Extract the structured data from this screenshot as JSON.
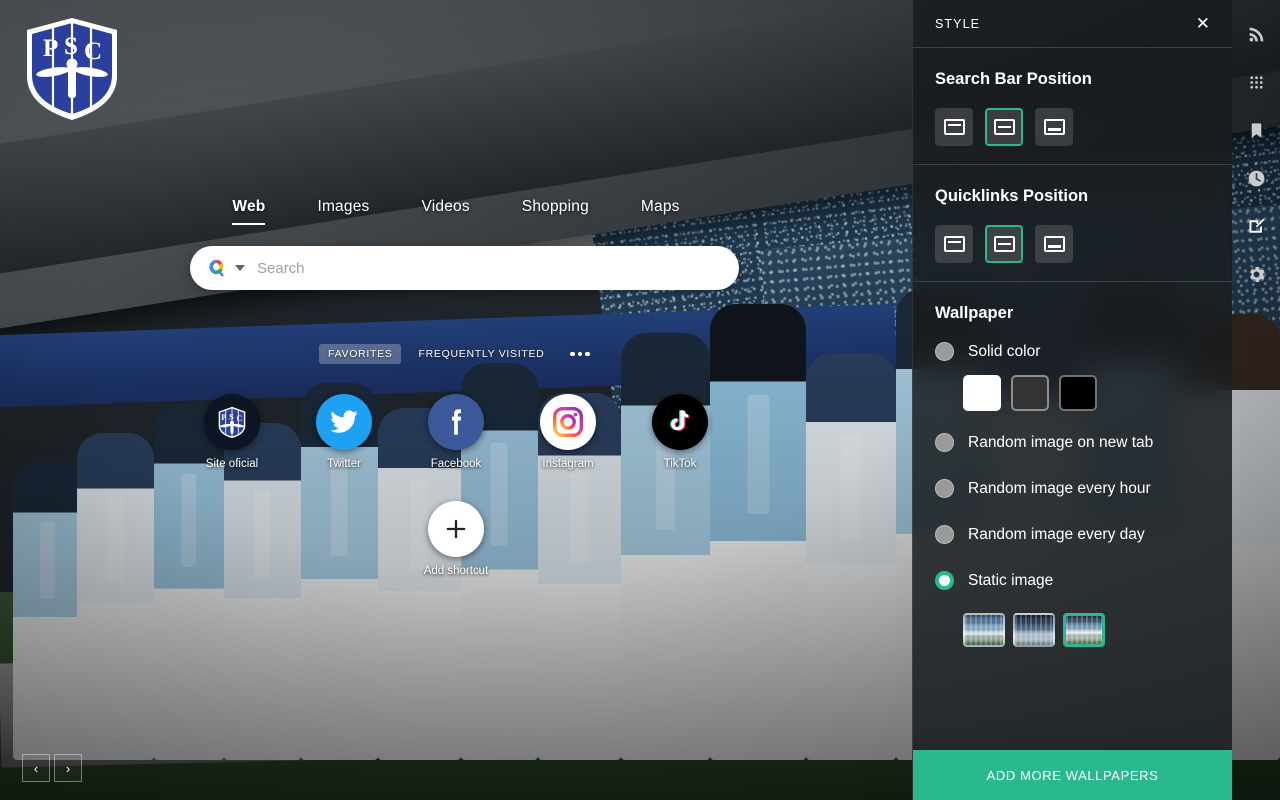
{
  "brand": {
    "logo_alt": "Paysandu Sport Club crest",
    "letters": [
      "P",
      "S",
      "C"
    ]
  },
  "search_tabs": [
    {
      "label": "Web",
      "active": true
    },
    {
      "label": "Images",
      "active": false
    },
    {
      "label": "Videos",
      "active": false
    },
    {
      "label": "Shopping",
      "active": false
    },
    {
      "label": "Maps",
      "active": false
    }
  ],
  "search": {
    "placeholder": "Search",
    "value": "",
    "engine_icon": "google-search-icon"
  },
  "favorites_bar": {
    "tabs": [
      {
        "label": "FAVORITES",
        "active": true
      },
      {
        "label": "FREQUENTLY VISITED",
        "active": false
      }
    ],
    "more_label": "more-options"
  },
  "shortcuts": [
    {
      "label": "Site oficial",
      "icon": "psc-crest-icon"
    },
    {
      "label": "Twitter",
      "icon": "twitter-icon"
    },
    {
      "label": "Facebook",
      "icon": "facebook-icon"
    },
    {
      "label": "Instagram",
      "icon": "instagram-icon"
    },
    {
      "label": "TikTok",
      "icon": "tiktok-icon"
    }
  ],
  "add_shortcut": {
    "label": "Add shortcut",
    "icon": "plus-icon"
  },
  "carousel": {
    "prev": "‹",
    "next": "›"
  },
  "panel": {
    "title": "STYLE",
    "close": "✕",
    "search_bar_position": {
      "title": "Search Bar Position",
      "options": [
        {
          "name": "top",
          "selected": false
        },
        {
          "name": "middle",
          "selected": true
        },
        {
          "name": "bottom",
          "selected": false
        }
      ]
    },
    "quicklinks_position": {
      "title": "Quicklinks Position",
      "options": [
        {
          "name": "top",
          "selected": false
        },
        {
          "name": "middle",
          "selected": true
        },
        {
          "name": "bottom",
          "selected": false
        }
      ]
    },
    "wallpaper": {
      "title": "Wallpaper",
      "solid_color": {
        "label": "Solid color",
        "selected": false
      },
      "solid_swatches": [
        {
          "name": "white",
          "hex": "#ffffff",
          "selected": false
        },
        {
          "name": "gray",
          "hex": "#333333",
          "selected": false
        },
        {
          "name": "black",
          "hex": "#000000",
          "selected": false
        }
      ],
      "modes": [
        {
          "label": "Random image on new tab",
          "selected": false
        },
        {
          "label": "Random image every hour",
          "selected": false
        },
        {
          "label": "Random image every day",
          "selected": false
        },
        {
          "label": "Static image",
          "selected": true
        }
      ],
      "thumbnails": [
        {
          "name": "wallpaper-1",
          "selected": false
        },
        {
          "name": "wallpaper-2",
          "selected": false
        },
        {
          "name": "wallpaper-3",
          "selected": true
        }
      ]
    },
    "add_more_label": "ADD MORE WALLPAPERS",
    "accent_color": "#2ab98d"
  },
  "rail": [
    {
      "name": "rss-feed-icon",
      "active": false
    },
    {
      "name": "apps-grid-icon",
      "active": false
    },
    {
      "name": "bookmark-icon",
      "active": false
    },
    {
      "name": "history-clock-icon",
      "active": false
    },
    {
      "name": "notes-edit-icon",
      "active": true
    },
    {
      "name": "settings-gear-icon",
      "active": false
    }
  ]
}
